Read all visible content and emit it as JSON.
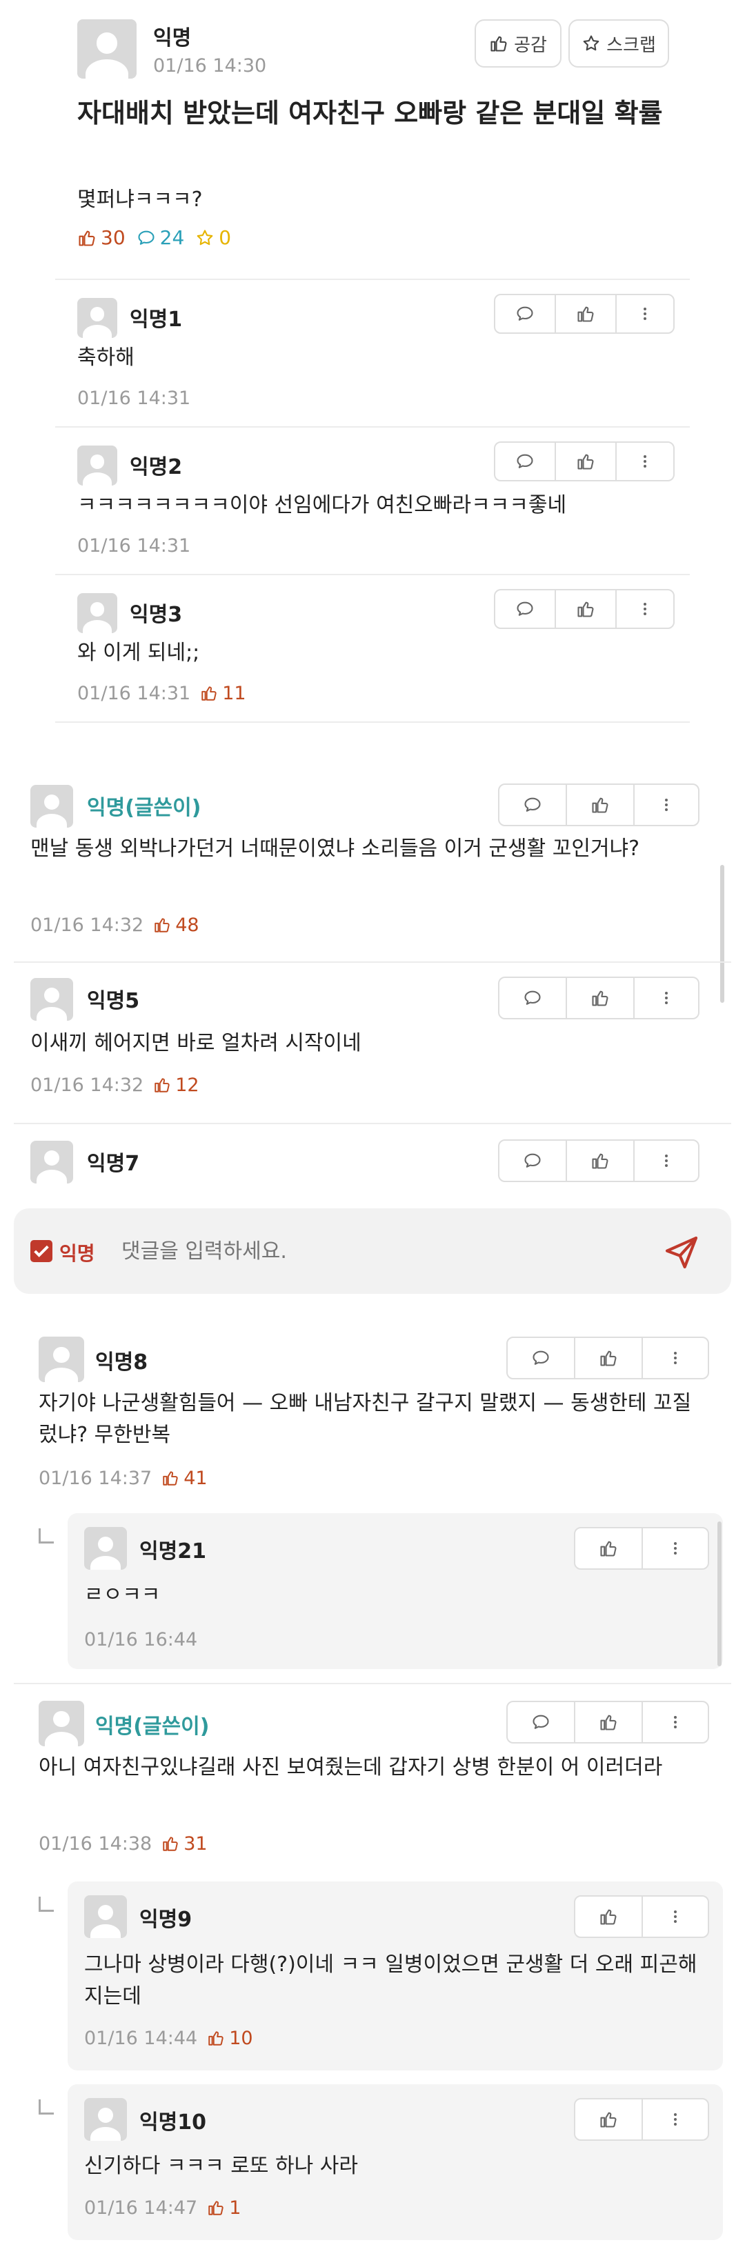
{
  "post": {
    "author": "익명",
    "time": "01/16 14:30",
    "empathy_label": "공감",
    "scrap_label": "스크랩",
    "title": "자대배치 받았는데 여자친구 오빠랑 같은 분대일 확률",
    "body": "몇퍼냐ㅋㅋㅋ?",
    "likes": "30",
    "comments": "24",
    "scraps": "0"
  },
  "comments": [
    {
      "author": "익명1",
      "text": "축하해",
      "time": "01/16 14:31",
      "likes": ""
    },
    {
      "author": "익명2",
      "text": "ㅋㅋㅋㅋㅋㅋㅋㅋ이야 선임에다가 여친오빠라ㅋㅋㅋ좋네",
      "time": "01/16 14:31",
      "likes": ""
    },
    {
      "author": "익명3",
      "text": "와 이게 되네;;",
      "time": "01/16 14:31",
      "likes": "11"
    },
    {
      "author": "익명(글쓴이)",
      "text": "맨날 동생 외박나가던거 너때문이였냐 소리들음 이거 군생활 꼬인거냐?",
      "time": "01/16 14:32",
      "likes": "48"
    },
    {
      "author": "익명5",
      "text": "이새끼 헤어지면 바로 얼차려 시작이네",
      "time": "01/16 14:32",
      "likes": "12"
    },
    {
      "author": "익명7",
      "text": "",
      "time": "",
      "likes": ""
    }
  ],
  "composer": {
    "anon_label": "익명",
    "placeholder": "댓글을 입력하세요."
  },
  "comments2": [
    {
      "author": "익명8",
      "text": "자기야 나군생활힘들어 — 오빠 내남자친구 갈구지 말랬지 — 동생한테 꼬질렀냐? 무한반복",
      "time": "01/16 14:37",
      "likes": "41"
    },
    {
      "author": "익명21",
      "text": "ㄹㅇㅋㅋ",
      "time": "01/16 16:44",
      "likes": ""
    },
    {
      "author": "익명(글쓴이)",
      "text": "아니 여자친구있냐길래 사진 보여줬는데 갑자기 상병 한분이 어 이러더라",
      "time": "01/16 14:38",
      "likes": "31"
    },
    {
      "author": "익명9",
      "text": "그나마 상병이라 다행(?)이네 ㅋㅋ 일병이었으면 군생활 더 오래 피곤해지는데",
      "time": "01/16 14:44",
      "likes": "10"
    },
    {
      "author": "익명10",
      "text": "신기하다 ㅋㅋㅋ 로또 하나 사라",
      "time": "01/16 14:47",
      "likes": "1"
    }
  ],
  "colors": {
    "op_name": "#2f9a9c",
    "like": "#c04a1f",
    "comment_count": "#2aa0b8",
    "scrap_star": "#e6b400",
    "anon_check": "#c0392b"
  }
}
